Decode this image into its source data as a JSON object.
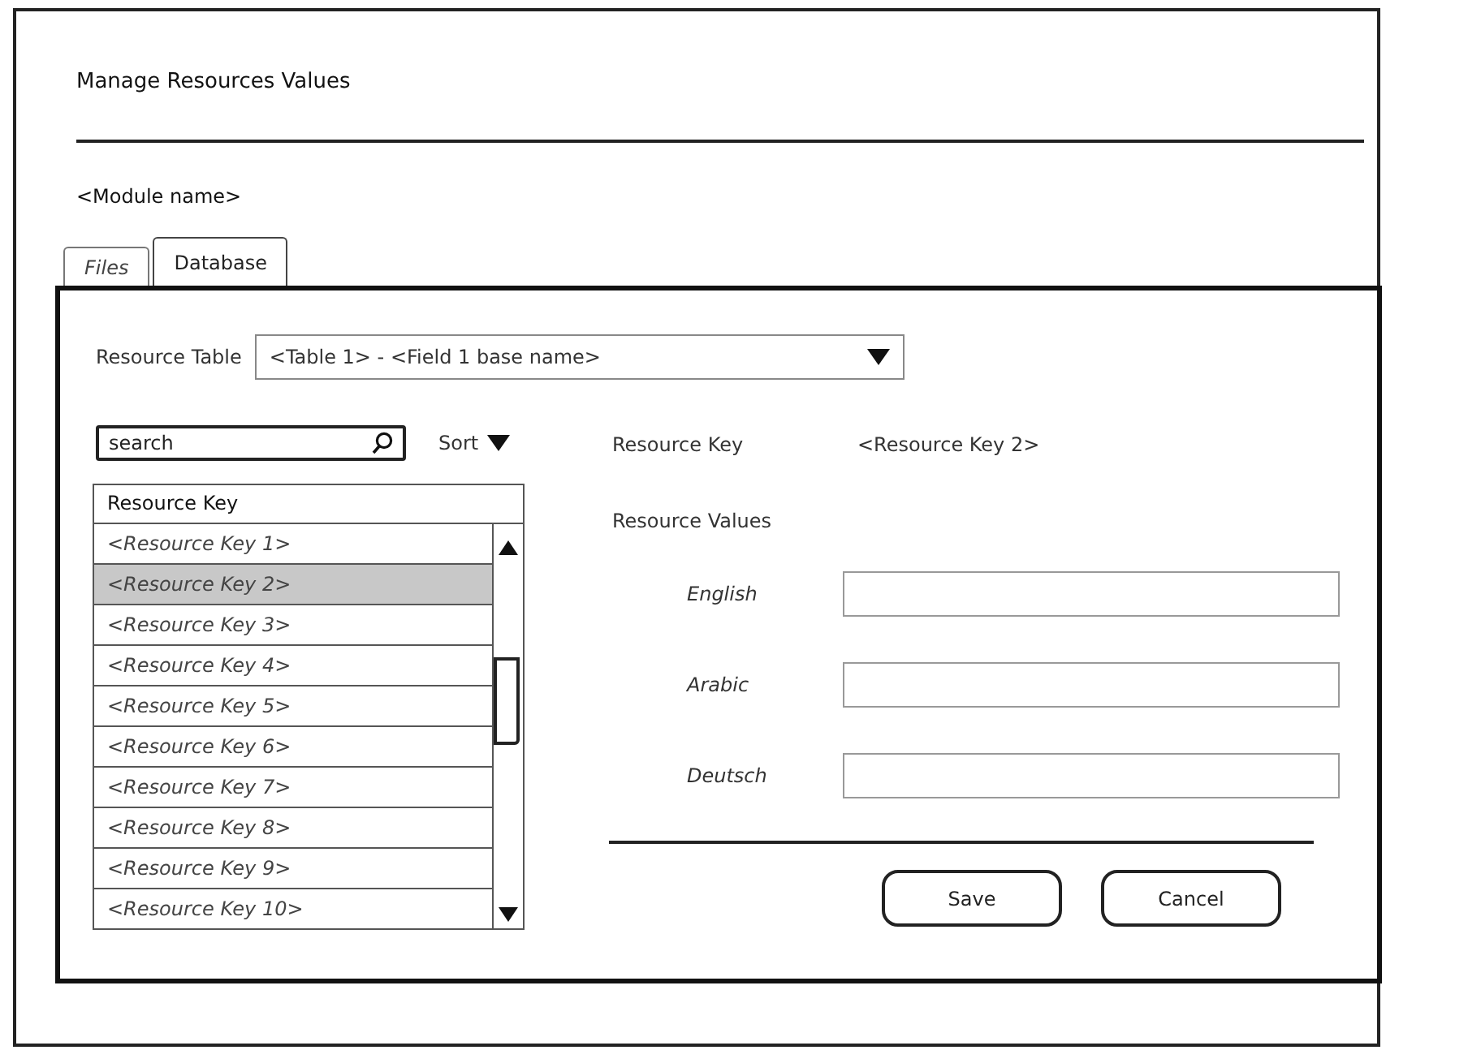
{
  "window": {
    "title": "Manage Resources Values"
  },
  "module_name": "<Module name>",
  "tabs": [
    {
      "label": "Files",
      "selected": false
    },
    {
      "label": "Database",
      "selected": true
    }
  ],
  "resource_table": {
    "label": "Resource Table",
    "value": "<Table 1> - <Field 1 base name>"
  },
  "search": {
    "placeholder": "search"
  },
  "sort": {
    "label": "Sort"
  },
  "key_list": {
    "header": "Resource Key",
    "rows": [
      {
        "label": "<Resource Key 1>",
        "selected": false
      },
      {
        "label": "<Resource Key 2>",
        "selected": true
      },
      {
        "label": "<Resource Key 3>",
        "selected": false
      },
      {
        "label": "<Resource Key 4>",
        "selected": false
      },
      {
        "label": "<Resource Key 5>",
        "selected": false
      },
      {
        "label": "<Resource Key 6>",
        "selected": false
      },
      {
        "label": "<Resource Key 7>",
        "selected": false
      },
      {
        "label": "<Resource Key 8>",
        "selected": false
      },
      {
        "label": "<Resource Key 9>",
        "selected": false
      },
      {
        "label": "<Resource Key 10>",
        "selected": false
      }
    ]
  },
  "detail": {
    "key_label": "Resource Key",
    "key_value": "<Resource Key 2>",
    "values_label": "Resource Values",
    "languages": [
      {
        "label": "English"
      },
      {
        "label": "Arabic"
      },
      {
        "label": "Deutsch"
      }
    ]
  },
  "buttons": [
    {
      "label": "Save"
    },
    {
      "label": "Cancel"
    }
  ]
}
